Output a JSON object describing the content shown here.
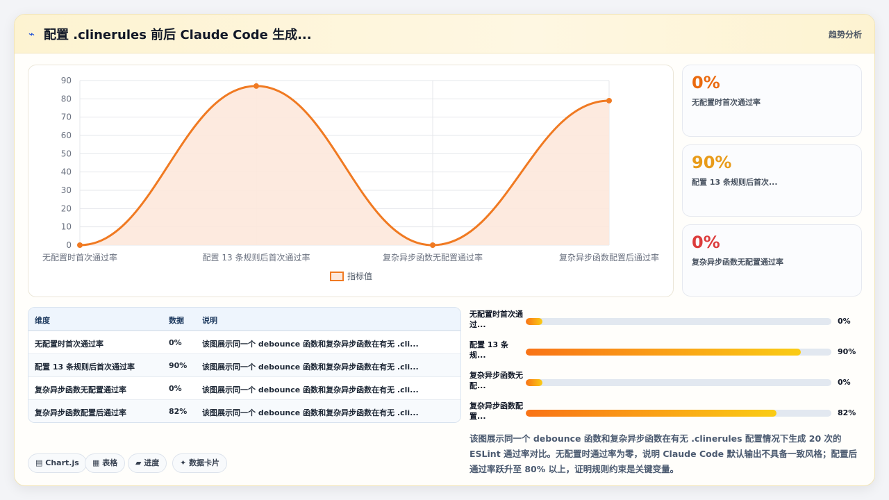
{
  "header": {
    "icon": "lightning-icon",
    "title": "配置 .clinerules 前后 Claude Code 生成...",
    "action_label": "趋势分析"
  },
  "chart_data": {
    "type": "line",
    "categories": [
      "无配置时首次通过率",
      "配置 13 条规则后首次通过率",
      "复杂异步函数无配置通过率",
      "复杂异步函数配置后通过率"
    ],
    "series": [
      {
        "name": "指标值",
        "values": [
          0,
          87,
          0,
          79
        ]
      }
    ],
    "ylim": [
      0,
      90
    ],
    "yticks": [
      "0",
      "10",
      "20",
      "30",
      "40",
      "50",
      "60",
      "70",
      "80",
      "90"
    ],
    "smooth": true,
    "fill": true,
    "grid": true,
    "legend": "bottom",
    "line_color": "#f07a22",
    "fill_color": "#fde8dc"
  },
  "kpis": [
    {
      "value": "0%",
      "label": "无配置时首次通过率",
      "color": "#ea6a0f"
    },
    {
      "value": "90%",
      "label": "配置 13 条规则后首次...",
      "color": "#e89b1a"
    },
    {
      "value": "0%",
      "label": "复杂异步函数无配置通过率",
      "color": "#dc3c3c"
    }
  ],
  "table": {
    "headers": [
      "维度",
      "数据",
      "说明"
    ],
    "rows": [
      [
        "无配置时首次通过率",
        "0%",
        "该图展示同一个 debounce 函数和复杂异步函数在有无 .cli..."
      ],
      [
        "配置 13 条规则后首次通过率",
        "90%",
        "该图展示同一个 debounce 函数和复杂异步函数在有无 .cli..."
      ],
      [
        "复杂异步函数无配置通过率",
        "0%",
        "该图展示同一个 debounce 函数和复杂异步函数在有无 .cli..."
      ],
      [
        "复杂异步函数配置后通过率",
        "82%",
        "该图展示同一个 debounce 函数和复杂异步函数在有无 .cli..."
      ]
    ]
  },
  "progress": [
    {
      "label": "无配置时首次通过...",
      "value": "0%",
      "fraction": 0.0
    },
    {
      "label": "配置 13 条规...",
      "value": "90%",
      "fraction": 0.9
    },
    {
      "label": "复杂异步函数无配...",
      "value": "0%",
      "fraction": 0.0
    },
    {
      "label": "复杂异步函数配置...",
      "value": "82%",
      "fraction": 0.82
    }
  ],
  "description": "该图展示同一个 debounce 函数和复杂异步函数在有无 .clinerules 配置情况下生成 20 次的 ESLint 通过率对比。无配置时通过率为零，说明 Claude Code 默认输出不具备一致风格；配置后通过率跃升至 80% 以上，证明规则约束是关键变量。",
  "tags": [
    {
      "icon": "chart-icon",
      "glyph": "▤",
      "label": "Chart.js"
    },
    {
      "icon": "table-icon",
      "glyph": "▦",
      "label": "表格"
    },
    {
      "icon": "progress-icon",
      "glyph": "▰",
      "label": "进度"
    },
    {
      "icon": "sparkle-icon",
      "glyph": "✦",
      "label": "数据卡片"
    }
  ]
}
